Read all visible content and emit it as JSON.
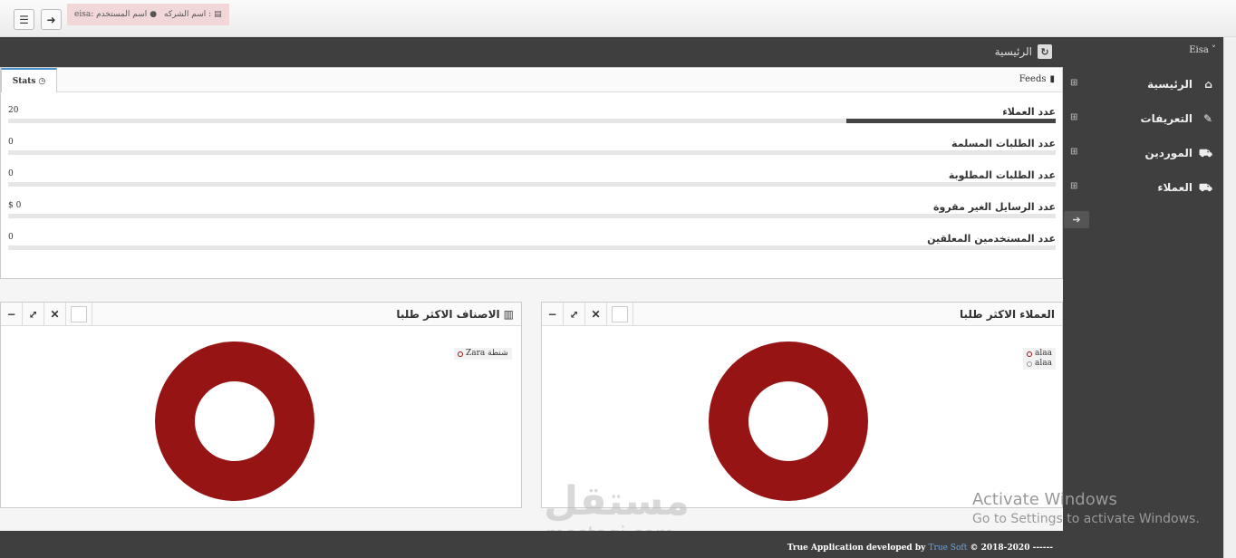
{
  "topbar": {
    "menu_icon": "hamburger-icon",
    "logout_icon": "sign-out-icon",
    "user_label": "eisa: اسم المستخدم",
    "company_label": "اسم الشركه :"
  },
  "header": {
    "title": "الرئيسية",
    "refresh_icon": "refresh-icon"
  },
  "sidebar": {
    "user": "Eisa",
    "items": [
      {
        "label": "الرئيسية",
        "icon": "home-icon"
      },
      {
        "label": "التعريفات",
        "icon": "edit-icon"
      },
      {
        "label": "الموردين",
        "icon": "cart-icon"
      },
      {
        "label": "العملاء",
        "icon": "cart-icon"
      }
    ]
  },
  "stats": {
    "tab_label": "Stats",
    "feeds_label": "Feeds",
    "rows": [
      {
        "label": "عدد العملاء",
        "value": "20",
        "fill_fraction": 0.2
      },
      {
        "label": "عدد الطلبات المسلمة",
        "value": "0",
        "fill_fraction": 0
      },
      {
        "label": "عدد الطلبات المطلوبة",
        "value": "0",
        "fill_fraction": 0
      },
      {
        "label": "عدد الرسايل الغير مقروة",
        "value": "$ 0",
        "fill_fraction": 0
      },
      {
        "label": "عدد المستخدمين المعلقين",
        "value": "0",
        "fill_fraction": 0
      }
    ]
  },
  "panels": {
    "customers": {
      "title": "العملاء الاكثر طلبا",
      "legend": [
        "alaa",
        "alaa"
      ]
    },
    "categories": {
      "title": "الاصناف الاكثر طلبا",
      "legend": [
        "Zara شنطة"
      ]
    }
  },
  "footer": {
    "prefix": "True Application developed by",
    "link": "True Soft",
    "suffix": "© 2018-2020 ------"
  },
  "watermarks": {
    "activate_title": "Activate Windows",
    "activate_sub": "Go to Settings to activate Windows.",
    "site_ar": "مستقل",
    "site_en": "mostaqi.com"
  },
  "colors": {
    "donut": "#971414",
    "dark": "#3f3f3f",
    "pill": "#f2d7d9"
  }
}
